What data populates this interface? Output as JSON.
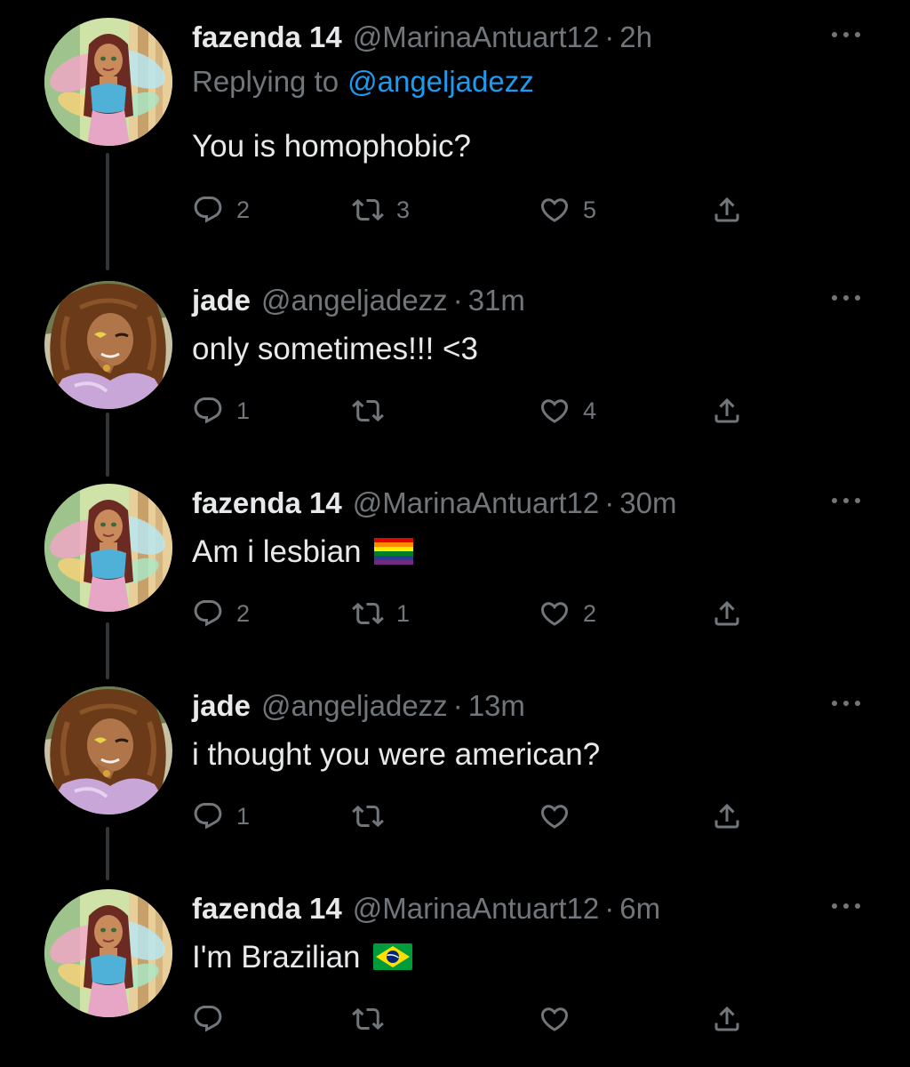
{
  "thread": {
    "tweets": [
      {
        "display_name": "fazenda 14",
        "handle": "@MarinaAntuart12",
        "dot": "·",
        "time": "2h",
        "replying_prefix": "Replying to",
        "replying_mention": "@angeljadezz",
        "text": "You is homophobic?",
        "flag": "",
        "avatar": "winx-fairy-avatar",
        "replies": "2",
        "retweets": "3",
        "likes": "5"
      },
      {
        "display_name": "jade",
        "handle": "@angeljadezz",
        "dot": "·",
        "time": "31m",
        "text": "only sometimes!!! <3",
        "flag": "",
        "avatar": "monster-high-avatar",
        "replies": "1",
        "retweets": "",
        "likes": "4"
      },
      {
        "display_name": "fazenda 14",
        "handle": "@MarinaAntuart12",
        "dot": "·",
        "time": "30m",
        "text": "Am i lesbian",
        "flag": "rainbow-flag",
        "avatar": "winx-fairy-avatar",
        "replies": "2",
        "retweets": "1",
        "likes": "2"
      },
      {
        "display_name": "jade",
        "handle": "@angeljadezz",
        "dot": "·",
        "time": "13m",
        "text": "i thought you were american?",
        "flag": "",
        "avatar": "monster-high-avatar",
        "replies": "1",
        "retweets": "",
        "likes": ""
      },
      {
        "display_name": "fazenda 14",
        "handle": "@MarinaAntuart12",
        "dot": "·",
        "time": "6m",
        "text": "I'm Brazilian",
        "flag": "brazil-flag",
        "avatar": "winx-fairy-avatar",
        "replies": "",
        "retweets": "",
        "likes": ""
      }
    ]
  },
  "icons": {
    "reply": "reply-icon",
    "retweet": "retweet-icon",
    "like": "heart-icon",
    "share": "share-icon",
    "more": "more-icon"
  },
  "colors": {
    "background": "#000000",
    "text": "#e7e9ea",
    "secondary": "#71767b",
    "link": "#1d9bf0",
    "thread_line": "#333639"
  }
}
